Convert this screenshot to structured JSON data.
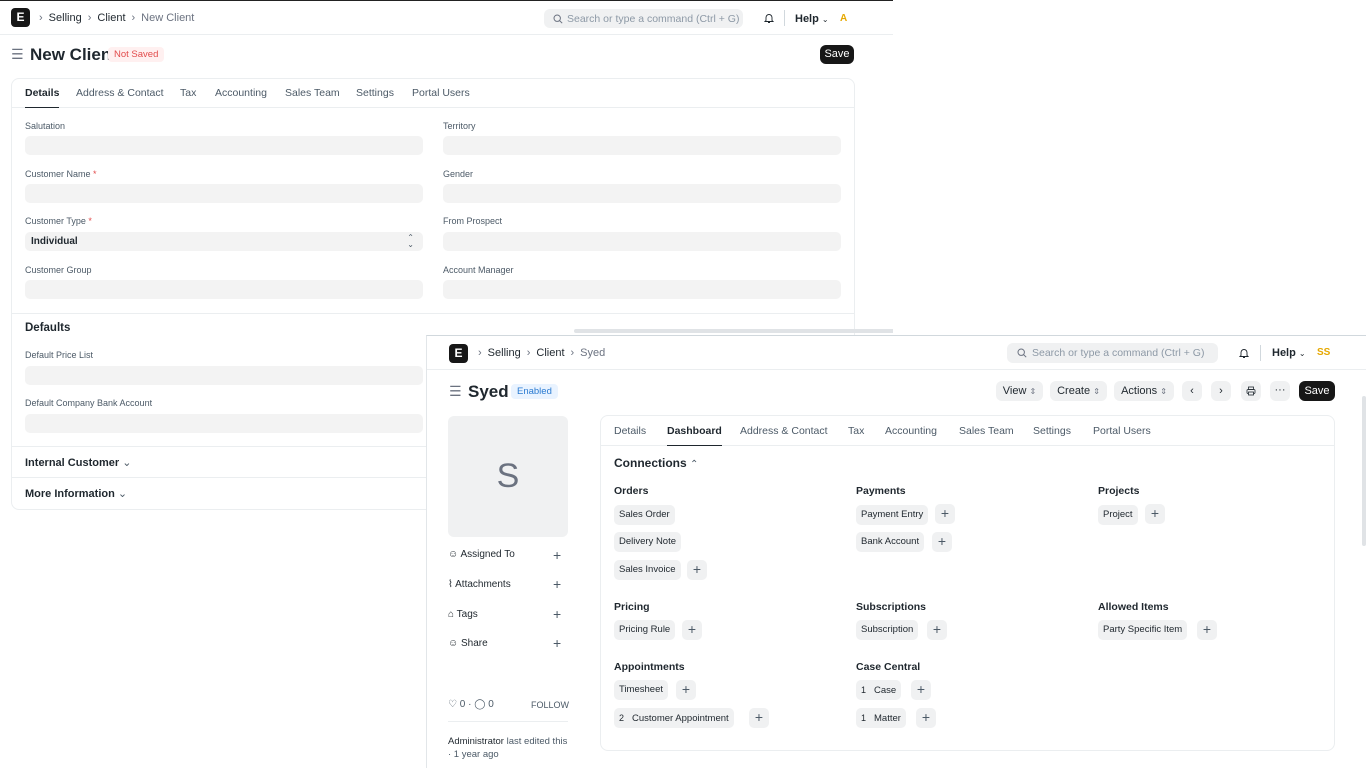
{
  "back_window": {
    "nav": {
      "logo": "E",
      "breadcrumbs": [
        "Selling",
        "Client",
        "New Client"
      ],
      "search_placeholder": "Search or type a command (Ctrl + G)",
      "help_label": "Help",
      "avatar": "A"
    },
    "page": {
      "title": "New Client",
      "status": "Not Saved",
      "save_label": "Save"
    },
    "tabs": [
      "Details",
      "Address & Contact",
      "Tax",
      "Accounting",
      "Sales Team",
      "Settings",
      "Portal Users"
    ],
    "fields": {
      "salutation": "Salutation",
      "territory": "Territory",
      "customer_name": "Customer Name",
      "gender": "Gender",
      "customer_type": "Customer Type",
      "customer_type_value": "Individual",
      "from_prospect": "From Prospect",
      "customer_group": "Customer Group",
      "account_manager": "Account Manager",
      "required_mark": "*"
    },
    "defaults": {
      "title": "Defaults",
      "price_list": "Default Price List",
      "bank_account": "Default Company Bank Account"
    },
    "sections": {
      "internal_customer": "Internal Customer",
      "more_information": "More Information"
    }
  },
  "front_window": {
    "nav": {
      "logo": "E",
      "breadcrumbs": [
        "Selling",
        "Client",
        "Syed"
      ],
      "search_placeholder": "Search or type a command (Ctrl + G)",
      "help_label": "Help",
      "avatar": "SS"
    },
    "page": {
      "title": "Syed",
      "status": "Enabled",
      "view_label": "View",
      "create_label": "Create",
      "actions_label": "Actions",
      "more_label": "···",
      "save_label": "Save"
    },
    "sidebar": {
      "image_letter": "S",
      "items": [
        "Assigned To",
        "Attachments",
        "Tags",
        "Share"
      ],
      "likes": "0",
      "comments": "0",
      "follow_label": "FOLLOW",
      "edited_by": "Administrator",
      "edited_text": "last edited this · 1 year ago"
    },
    "tabs": [
      "Details",
      "Dashboard",
      "Address & Contact",
      "Tax",
      "Accounting",
      "Sales Team",
      "Settings",
      "Portal Users"
    ],
    "connections": {
      "title": "Connections",
      "groups": {
        "orders": {
          "title": "Orders",
          "items": [
            "Sales Order",
            "Delivery Note",
            "Sales Invoice"
          ]
        },
        "payments": {
          "title": "Payments",
          "items": [
            "Payment Entry",
            "Bank Account"
          ]
        },
        "projects": {
          "title": "Projects",
          "items": [
            "Project"
          ]
        },
        "pricing": {
          "title": "Pricing",
          "items": [
            "Pricing Rule"
          ]
        },
        "subscriptions": {
          "title": "Subscriptions",
          "items": [
            "Subscription"
          ]
        },
        "allowed_items": {
          "title": "Allowed Items",
          "items": [
            "Party Specific Item"
          ]
        },
        "appointments": {
          "title": "Appointments",
          "items": [
            "Timesheet",
            "Customer Appointment"
          ],
          "counts": [
            "",
            "2"
          ]
        },
        "case_central": {
          "title": "Case Central",
          "items": [
            "Case",
            "Matter"
          ],
          "counts": [
            "1",
            "1"
          ]
        }
      }
    }
  }
}
